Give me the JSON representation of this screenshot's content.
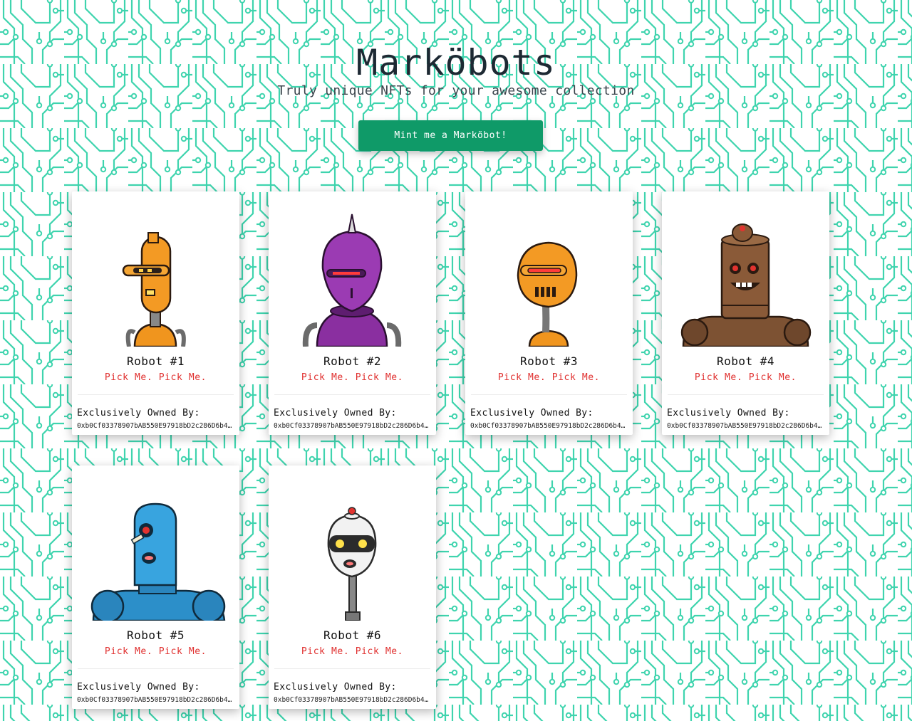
{
  "header": {
    "title": "Marköbots",
    "subtitle": "Truly unique NFTs for your awesome collection"
  },
  "mint_button": {
    "label": "Mint me a Marköbot!"
  },
  "colors": {
    "accent": "#0f9a68",
    "circuit": "#3fd4ae",
    "tagline": "#e0302f"
  },
  "cards": [
    {
      "title": "Robot #1",
      "tagline": "Pick Me. Pick Me.",
      "owner_label": "Exclusively Owned By:",
      "owner_address": "0xb0Cf03378907bAB550E97918bD2c286D6b4…",
      "robot": "orange-visor-robot"
    },
    {
      "title": "Robot #2",
      "tagline": "Pick Me. Pick Me.",
      "owner_label": "Exclusively Owned By:",
      "owner_address": "0xb0Cf03378907bAB550E97918bD2c286D6b4…",
      "robot": "purple-spike-robot"
    },
    {
      "title": "Robot #3",
      "tagline": "Pick Me. Pick Me.",
      "owner_label": "Exclusively Owned By:",
      "owner_address": "0xb0Cf03378907bAB550E97918bD2c286D6b4…",
      "robot": "orange-grill-robot"
    },
    {
      "title": "Robot #4",
      "tagline": "Pick Me. Pick Me.",
      "owner_label": "Exclusively Owned By:",
      "owner_address": "0xb0Cf03378907bAB550E97918bD2c286D6b4…",
      "robot": "brown-barrel-robot"
    },
    {
      "title": "Robot #5",
      "tagline": "Pick Me. Pick Me.",
      "owner_label": "Exclusively Owned By:",
      "owner_address": "0xb0Cf03378907bAB550E97918bD2c286D6b4…",
      "robot": "blue-cyclops-robot"
    },
    {
      "title": "Robot #6",
      "tagline": "Pick Me. Pick Me.",
      "owner_label": "Exclusively Owned By:",
      "owner_address": "0xb0Cf03378907bAB550E97918bD2c286D6b4…",
      "robot": "white-egg-robot"
    }
  ]
}
